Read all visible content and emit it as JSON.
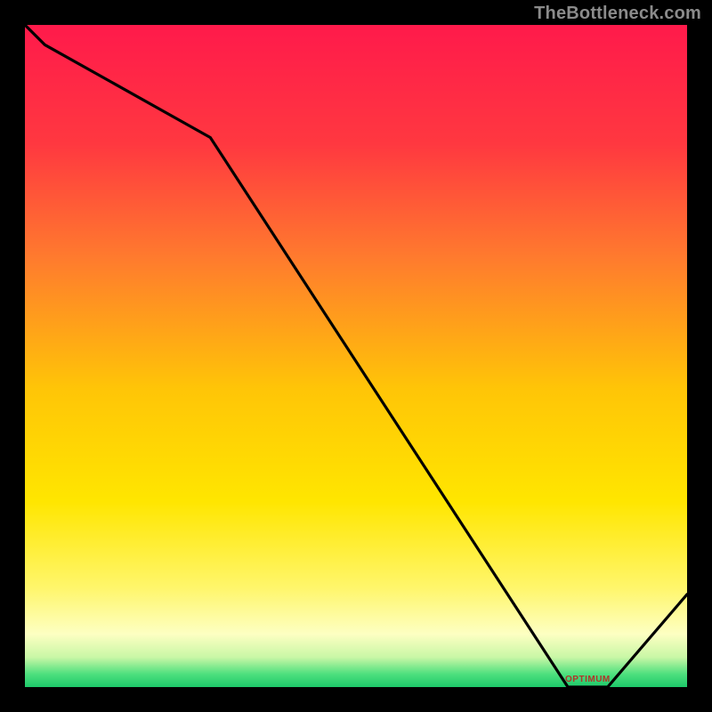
{
  "attribution": "TheBottleneck.com",
  "chart_data": {
    "type": "line",
    "title": "",
    "xlabel": "",
    "ylabel": "",
    "xlim": [
      0,
      100
    ],
    "ylim": [
      0,
      100
    ],
    "x": [
      0,
      3,
      28,
      82,
      88,
      100
    ],
    "values": [
      100,
      97,
      83,
      0,
      0,
      14
    ],
    "optimal_range": {
      "x_start": 82,
      "x_end": 88,
      "label": "OPTIMUM"
    },
    "background_gradient": {
      "stops": [
        {
          "pos": 0.0,
          "color": "#ff1a4b"
        },
        {
          "pos": 0.18,
          "color": "#ff3840"
        },
        {
          "pos": 0.35,
          "color": "#ff7a2e"
        },
        {
          "pos": 0.55,
          "color": "#ffc507"
        },
        {
          "pos": 0.72,
          "color": "#ffe600"
        },
        {
          "pos": 0.85,
          "color": "#fff66b"
        },
        {
          "pos": 0.92,
          "color": "#fdffc2"
        },
        {
          "pos": 0.955,
          "color": "#c9f7a6"
        },
        {
          "pos": 0.98,
          "color": "#4fe07e"
        },
        {
          "pos": 1.0,
          "color": "#1dc96a"
        }
      ]
    }
  },
  "colors": {
    "page_bg": "#000000",
    "line": "#000000",
    "attribution": "#8b8b8b",
    "range_label": "#b0352a"
  }
}
